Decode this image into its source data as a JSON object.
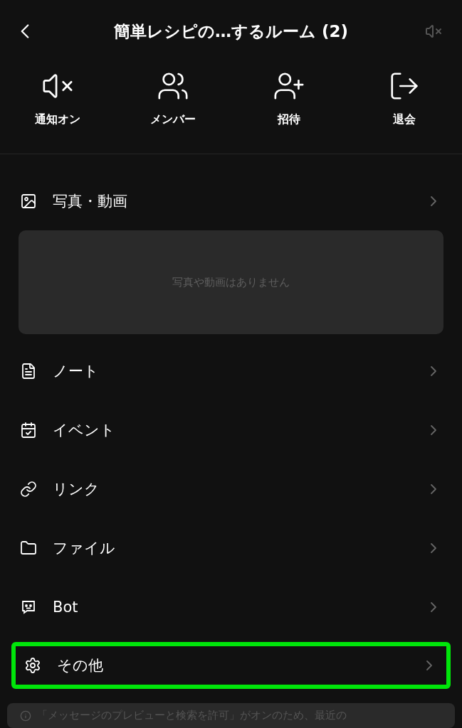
{
  "header": {
    "title": "簡単レシピの…するルーム (2)",
    "muted": true
  },
  "actions": [
    {
      "kind": "mute",
      "label": "通知オン"
    },
    {
      "kind": "members",
      "label": "メンバー"
    },
    {
      "kind": "invite",
      "label": "招待"
    },
    {
      "kind": "leave",
      "label": "退会"
    }
  ],
  "menu": [
    {
      "kind": "photos",
      "label": "写真・動画",
      "empty_text": "写真や動画はありません",
      "highlighted": false
    },
    {
      "kind": "note",
      "label": "ノート",
      "highlighted": false
    },
    {
      "kind": "event",
      "label": "イベント",
      "highlighted": false
    },
    {
      "kind": "link",
      "label": "リンク",
      "highlighted": false
    },
    {
      "kind": "file",
      "label": "ファイル",
      "highlighted": false
    },
    {
      "kind": "bot",
      "label": "Bot",
      "highlighted": false
    },
    {
      "kind": "other",
      "label": "その他",
      "highlighted": true
    }
  ],
  "notice": {
    "text": "「メッセージのプレビューと検索を許可」がオンのため、最近の"
  }
}
